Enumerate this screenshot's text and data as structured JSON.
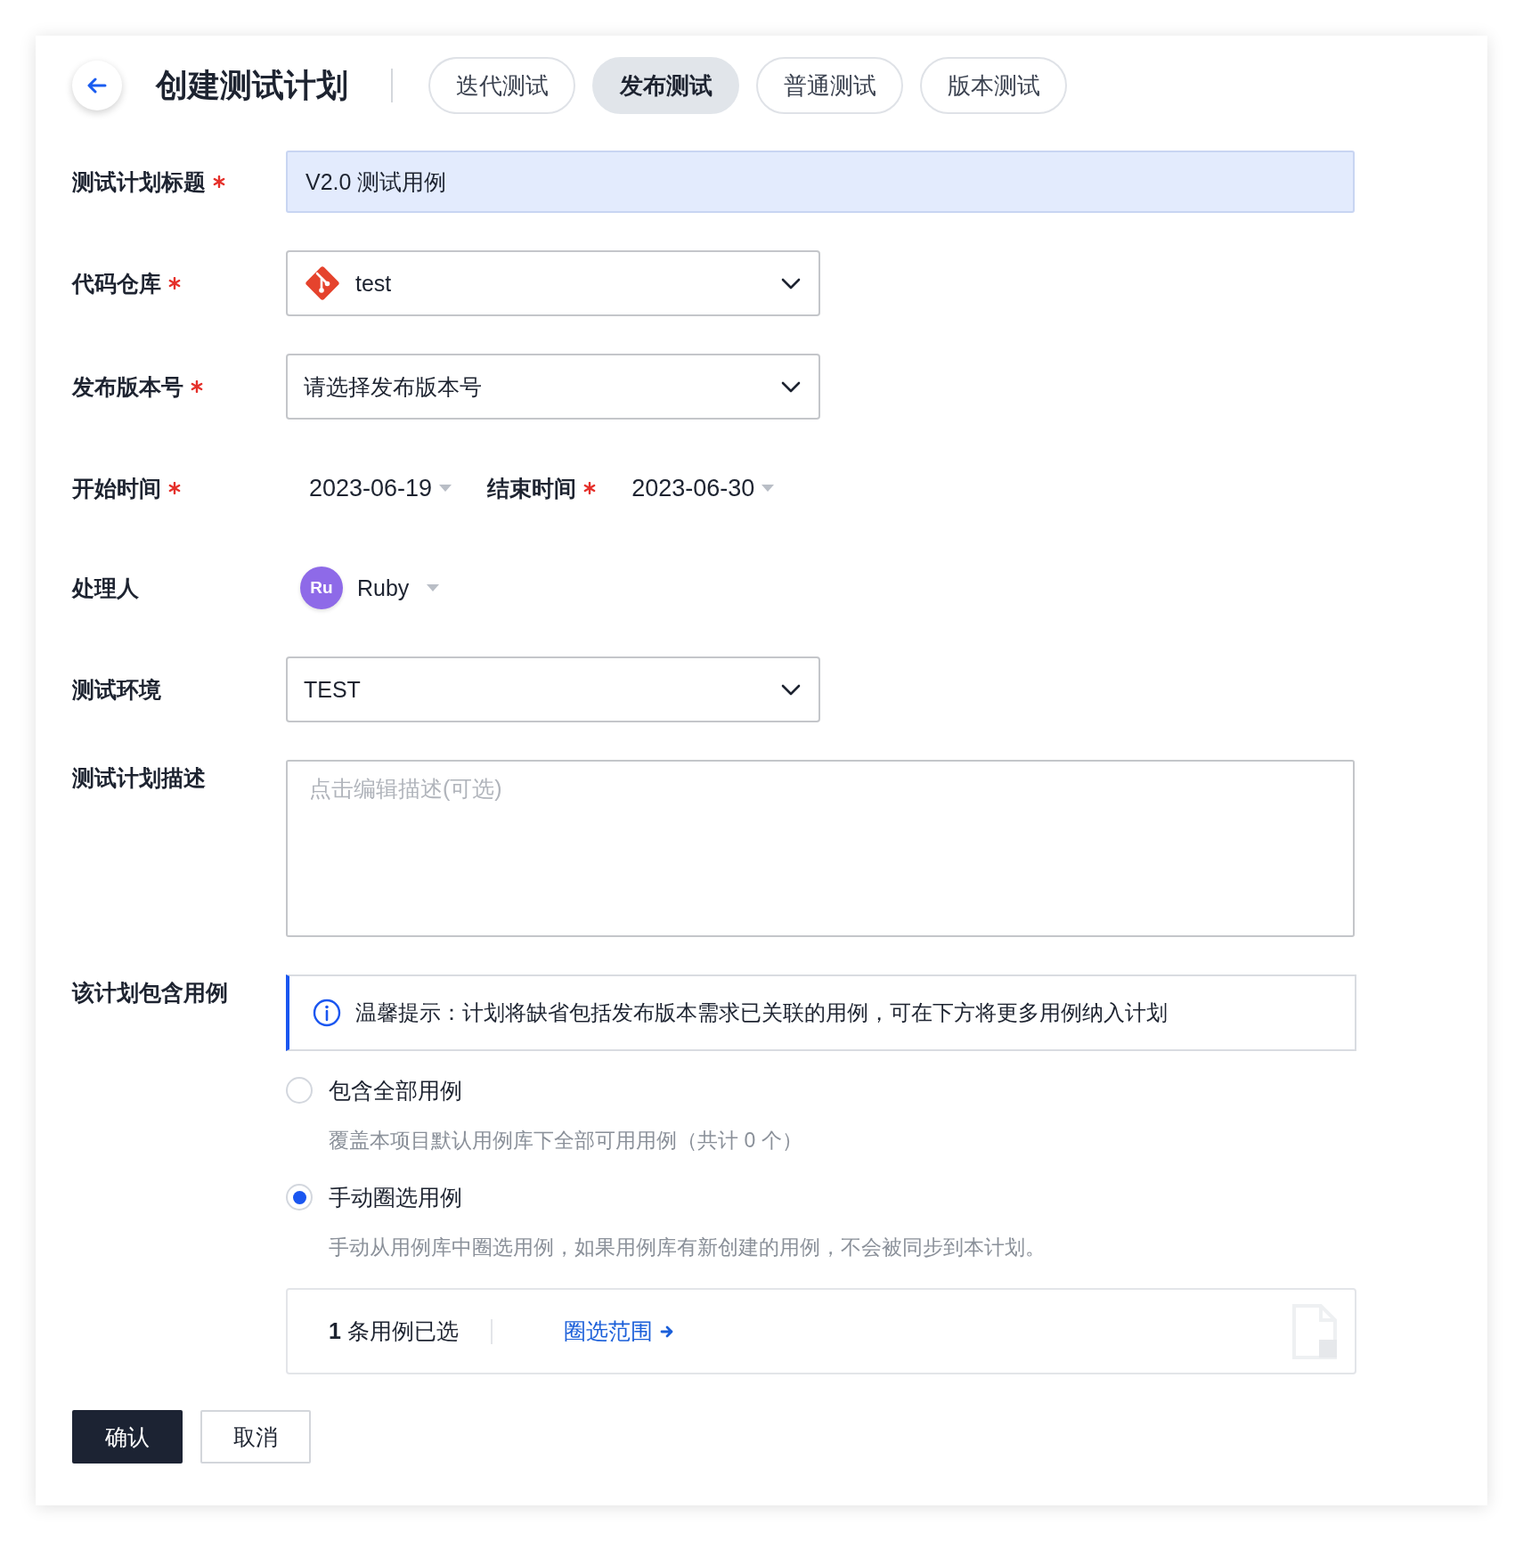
{
  "header": {
    "title": "创建测试计划",
    "tabs": [
      {
        "label": "迭代测试",
        "selected": false
      },
      {
        "label": "发布测试",
        "selected": true
      },
      {
        "label": "普通测试",
        "selected": false
      },
      {
        "label": "版本测试",
        "selected": false
      }
    ]
  },
  "fields": [
    {
      "kind": "text",
      "label": "测试计划标题",
      "required": true,
      "value": "V2.0 测试用例"
    },
    {
      "kind": "repo",
      "label": "代码仓库",
      "required": true,
      "value": "test"
    },
    {
      "kind": "select",
      "label": "发布版本号",
      "required": true,
      "value": "请选择发布版本号"
    },
    {
      "kind": "dates",
      "label": "开始时间",
      "required": true,
      "value": "2023-06-19",
      "end_label": "结束时间",
      "end_required": true,
      "end_value": "2023-06-30"
    },
    {
      "kind": "user",
      "label": "处理人",
      "required": false,
      "avatar": "Ru",
      "value": "Ruby"
    },
    {
      "kind": "select",
      "label": "测试环境",
      "required": false,
      "value": "TEST"
    },
    {
      "kind": "textarea",
      "label": "测试计划描述",
      "required": false,
      "placeholder": "点击编辑描述(可选)"
    },
    {
      "kind": "cases",
      "label": "该计划包含用例",
      "required": false,
      "notice": "温馨提示：计划将缺省包括发布版本需求已关联的用例，可在下方将更多用例纳入计划",
      "options": [
        {
          "label": "包含全部用例",
          "description": "覆盖本项目默认用例库下全部可用用例（共计 0 个）",
          "selected": false
        },
        {
          "label": "手动圈选用例",
          "description": "手动从用例库中圈选用例，如果用例库有新创建的用例，不会被同步到本计划。",
          "selected": true
        }
      ],
      "selection": {
        "count": "**1** 条用例已选",
        "link": "圈选范围"
      }
    }
  ],
  "actions": [
    {
      "label": "确认",
      "kind": "primary"
    },
    {
      "label": "取消",
      "kind": "secondary"
    }
  ]
}
